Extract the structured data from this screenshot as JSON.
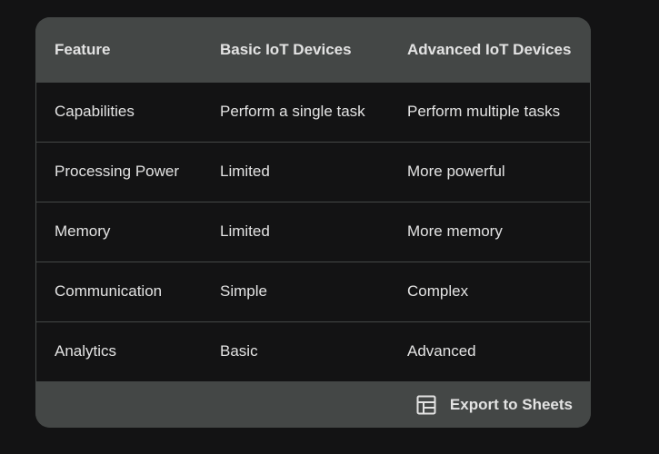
{
  "table": {
    "headers": [
      "Feature",
      "Basic IoT Devices",
      "Advanced IoT Devices"
    ],
    "rows": [
      [
        "Capabilities",
        "Perform a single task",
        "Perform multiple tasks"
      ],
      [
        "Processing Power",
        "Limited",
        "More powerful"
      ],
      [
        "Memory",
        "Limited",
        "More memory"
      ],
      [
        "Communication",
        "Simple",
        "Complex"
      ],
      [
        "Analytics",
        "Basic",
        "Advanced"
      ]
    ]
  },
  "footer": {
    "export_label": "Export to Sheets",
    "export_icon": "sheets-table-icon"
  },
  "colors": {
    "background": "#131314",
    "header_bg": "#444746",
    "text": "#e3e3e3",
    "divider": "#444746"
  }
}
